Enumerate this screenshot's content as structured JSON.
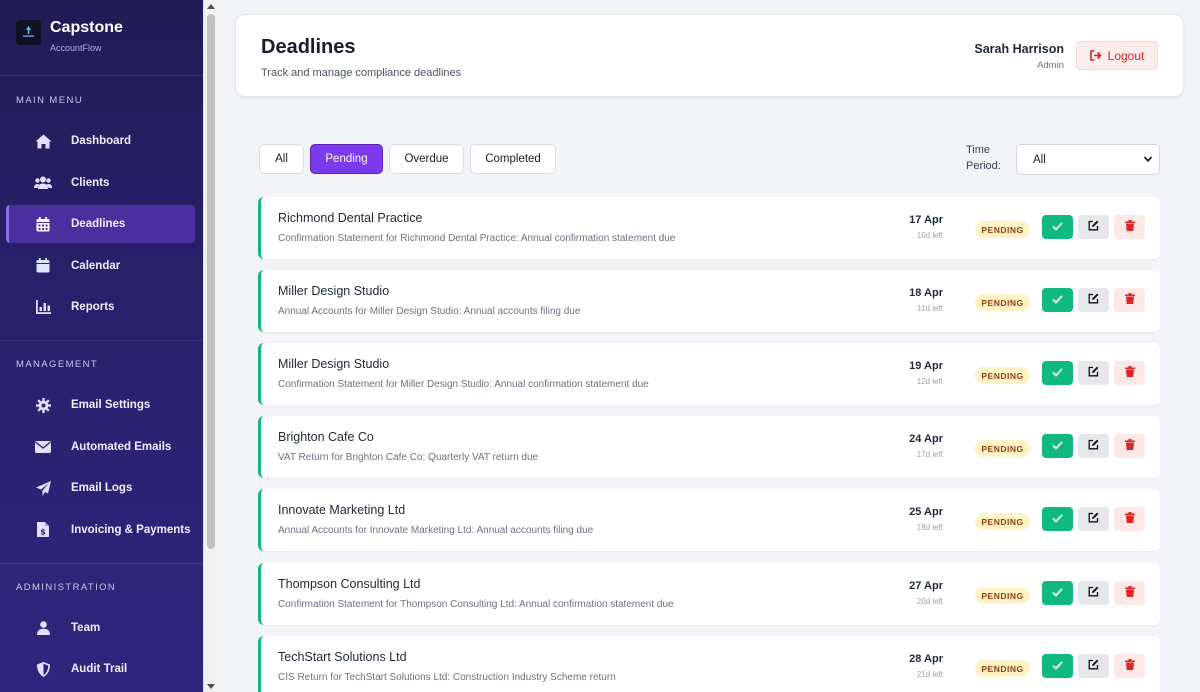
{
  "brand": {
    "name": "Capstone",
    "sub": "AccountFlow",
    "logo_text": "CAPSTONE"
  },
  "sidebar": {
    "sections": [
      {
        "label": "MAIN MENU",
        "items": [
          {
            "label": "Dashboard",
            "icon": "home-icon"
          },
          {
            "label": "Clients",
            "icon": "users-icon"
          },
          {
            "label": "Deadlines",
            "icon": "calendar-grid-icon",
            "active": true
          },
          {
            "label": "Calendar",
            "icon": "calendar-icon"
          },
          {
            "label": "Reports",
            "icon": "chart-bar-icon"
          }
        ]
      },
      {
        "label": "MANAGEMENT",
        "items": [
          {
            "label": "Email Settings",
            "icon": "gear-icon"
          },
          {
            "label": "Automated Emails",
            "icon": "envelope-icon"
          },
          {
            "label": "Email Logs",
            "icon": "paper-plane-icon"
          },
          {
            "label": "Invoicing & Payments",
            "icon": "invoice-icon"
          }
        ]
      },
      {
        "label": "ADMINISTRATION",
        "items": [
          {
            "label": "Team",
            "icon": "user-icon"
          },
          {
            "label": "Audit Trail",
            "icon": "shield-icon"
          }
        ]
      }
    ]
  },
  "header": {
    "title": "Deadlines",
    "subtitle": "Track and manage compliance deadlines",
    "user_name": "Sarah Harrison",
    "user_role": "Admin",
    "logout_label": "Logout"
  },
  "filters": {
    "tabs": [
      {
        "label": "All",
        "active": false
      },
      {
        "label": "Pending",
        "active": true
      },
      {
        "label": "Overdue",
        "active": false
      },
      {
        "label": "Completed",
        "active": false
      }
    ],
    "time_period_label": "Time Period:",
    "time_period_value": "All"
  },
  "deadlines": [
    {
      "client": "Richmond Dental Practice",
      "description": "Confirmation Statement for Richmond Dental Practice: Annual confirmation statement due",
      "date": "17 Apr",
      "left": "10d left",
      "status": "PENDING"
    },
    {
      "client": "Miller Design Studio",
      "description": "Annual Accounts for Miller Design Studio: Annual accounts filing due",
      "date": "18 Apr",
      "left": "11d left",
      "status": "PENDING"
    },
    {
      "client": "Miller Design Studio",
      "description": "Confirmation Statement for Miller Design Studio: Annual confirmation statement due",
      "date": "19 Apr",
      "left": "12d left",
      "status": "PENDING"
    },
    {
      "client": "Brighton Cafe Co",
      "description": "VAT Return for Brighton Cafe Co: Quarterly VAT return due",
      "date": "24 Apr",
      "left": "17d left",
      "status": "PENDING"
    },
    {
      "client": "Innovate Marketing Ltd",
      "description": "Annual Accounts for Innovate Marketing Ltd: Annual accounts filing due",
      "date": "25 Apr",
      "left": "18d left",
      "status": "PENDING"
    },
    {
      "client": "Thompson Consulting Ltd",
      "description": "Confirmation Statement for Thompson Consulting Ltd: Annual confirmation statement due",
      "date": "27 Apr",
      "left": "20d left",
      "status": "PENDING"
    },
    {
      "client": "TechStart Solutions Ltd",
      "description": "CIS Return for TechStart Solutions Ltd: Construction Industry Scheme return",
      "date": "28 Apr",
      "left": "21d left",
      "status": "PENDING"
    }
  ],
  "colors": {
    "accent": "#7c3aed",
    "success": "#10b981",
    "danger": "#dc2626",
    "pending_bg": "#fef3c7",
    "pending_text": "#92400e"
  }
}
